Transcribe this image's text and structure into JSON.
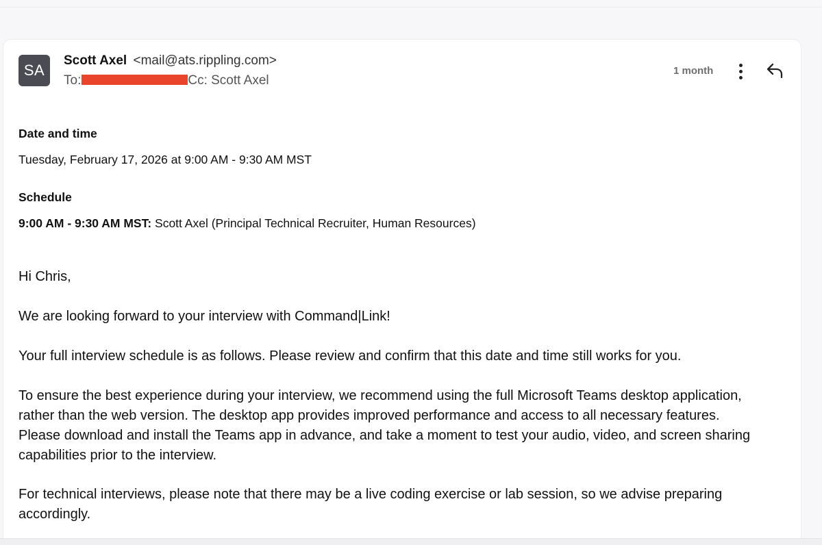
{
  "email": {
    "avatar_initials": "SA",
    "sender_name": "Scott Axel",
    "sender_email": "<mail@ats.rippling.com>",
    "to_label": "To:",
    "cc_text": "Cc: Scott Axel",
    "time_ago": "1 month",
    "icons": {
      "more": "more-vertical-icon",
      "reply": "reply-icon"
    },
    "redaction_color": "#e8452c"
  },
  "details": {
    "date_heading": "Date and time",
    "date_value": "Tuesday, February 17, 2026 at 9:00 AM - 9:30 AM MST",
    "schedule_heading": "Schedule",
    "schedule_time": "9:00 AM - 9:30 AM MST:",
    "schedule_person": "Scott Axel (Principal Technical Recruiter, Human Resources)"
  },
  "message": {
    "greeting": "Hi Chris,",
    "para1": "We are looking forward to your interview with Command|Link!",
    "para2": "Your full interview schedule is as follows. Please review and confirm that this date and time still works for you.",
    "para3_lines": [
      "To ensure the best experience during your interview, we recommend using the full Microsoft Teams desktop application,",
      "rather than the web version. The desktop app provides improved performance and access to all necessary features.",
      "Please download and install the Teams app in advance, and take a moment to test your audio, video, and screen sharing",
      "capabilities prior to the interview."
    ],
    "para4_lines": [
      "For technical interviews, please note that there may be a live coding exercise or lab session, so we advise preparing",
      "accordingly."
    ]
  }
}
